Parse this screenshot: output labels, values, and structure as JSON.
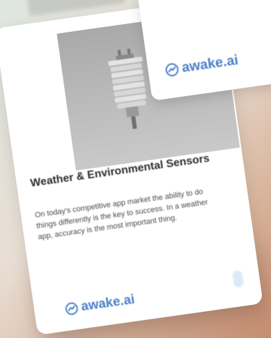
{
  "colors": {
    "brand": "#4a7fc7",
    "card_bg": "#ffffff",
    "image_bg": "#b3b3b3"
  },
  "card": {
    "image_icon": "weather-sensor-icon",
    "title": "Weather & Environmental Sensors",
    "description": "On today's competitive app market the ability to do things differently is the key to success. In a weather app, accuracy is the most important thing.",
    "brand_icon": "awake-logo-icon",
    "brand_name": "awake.ai"
  },
  "top_card": {
    "brand_icon": "awake-logo-icon",
    "brand_name": "awake.ai"
  }
}
